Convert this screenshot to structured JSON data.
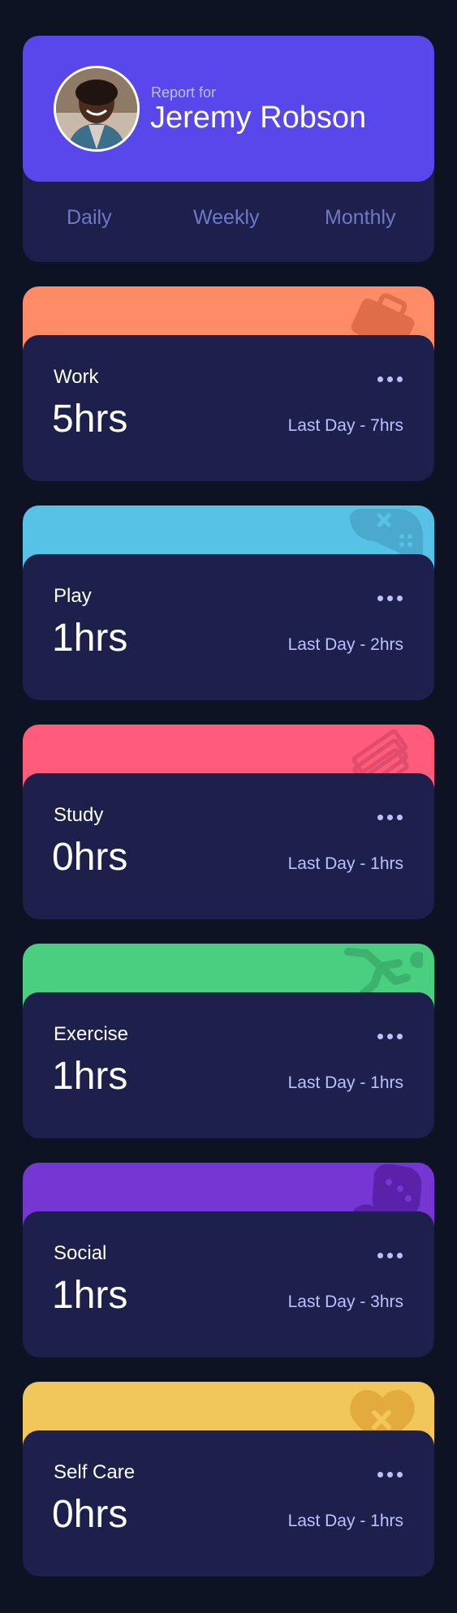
{
  "profile": {
    "report_for": "Report for",
    "name": "Jeremy Robson",
    "accent": "#5847eb"
  },
  "timeframes": [
    {
      "label": "Daily"
    },
    {
      "label": "Weekly"
    },
    {
      "label": "Monthly"
    }
  ],
  "cards": [
    {
      "title": "Work",
      "hours": "5hrs",
      "previous": "Last Day - 7hrs",
      "color": "#ff8c66",
      "icon": "briefcase-icon"
    },
    {
      "title": "Play",
      "hours": "1hrs",
      "previous": "Last Day - 2hrs",
      "color": "#56c2e6",
      "icon": "gamepad-icon"
    },
    {
      "title": "Study",
      "hours": "0hrs",
      "previous": "Last Day - 1hrs",
      "color": "#ff5c7c",
      "icon": "books-icon"
    },
    {
      "title": "Exercise",
      "hours": "1hrs",
      "previous": "Last Day - 1hrs",
      "color": "#4acf81",
      "icon": "running-icon"
    },
    {
      "title": "Social",
      "hours": "1hrs",
      "previous": "Last Day - 3hrs",
      "color": "#7536d3",
      "icon": "chat-icon"
    },
    {
      "title": "Self Care",
      "hours": "0hrs",
      "previous": "Last Day - 1hrs",
      "color": "#f1c65b",
      "icon": "heart-icon"
    }
  ],
  "colors": {
    "page_bg": "#0d1323",
    "card_bg": "#1c204b",
    "muted_text": "#bbc0ff",
    "timeframe_text": "#7078c9"
  }
}
